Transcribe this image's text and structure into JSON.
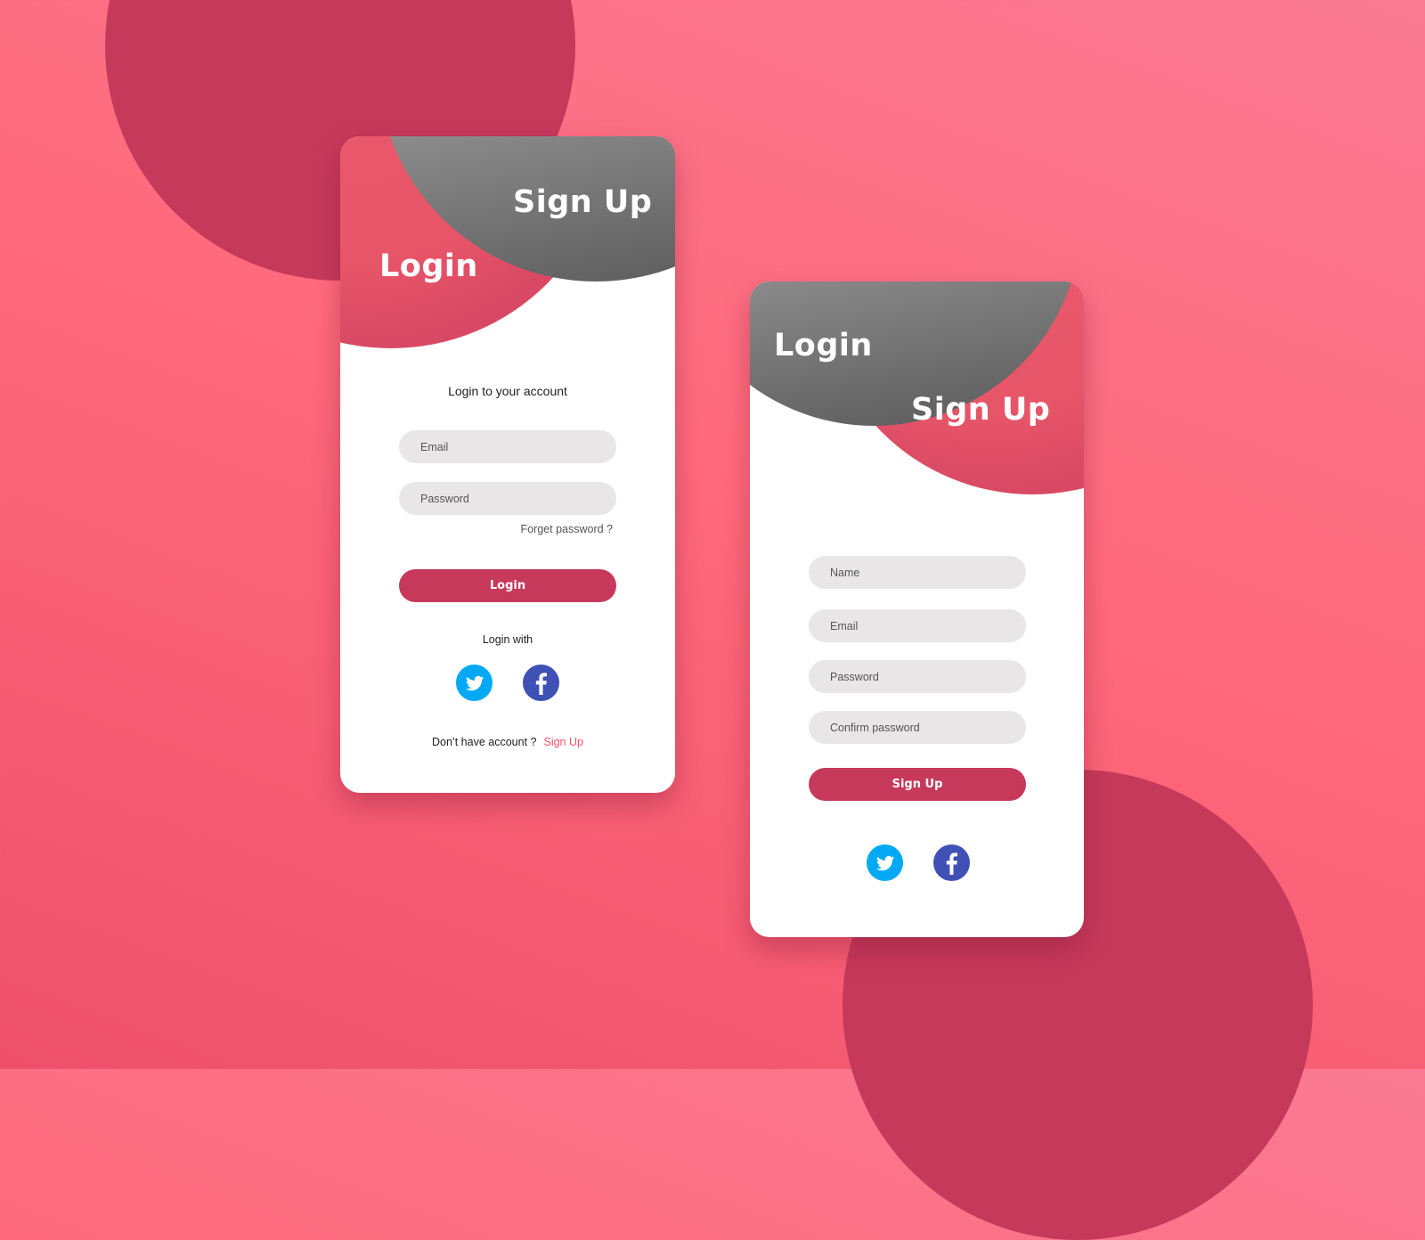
{
  "colors": {
    "background_light": "#fa7a93",
    "background_dark": "#ee506b",
    "accent": "#c6395b",
    "header_pink": "#e75569",
    "header_gray": "#8e8e8e",
    "input_bg": "#e8e6e7",
    "link": "#f0506b",
    "twitter": "#03a9f4",
    "facebook": "#3f51b5"
  },
  "login_card": {
    "header": {
      "primary_label": "Login",
      "secondary_label": "Sign Up"
    },
    "subtitle": "Login to your account",
    "fields": [
      {
        "name": "email",
        "placeholder": "Email",
        "value": ""
      },
      {
        "name": "password",
        "placeholder": "Password",
        "value": ""
      }
    ],
    "forget_password": "Forget password ?",
    "submit_label": "Login",
    "social_label": "Login with",
    "social": [
      {
        "icon": "twitter-icon"
      },
      {
        "icon": "facebook-icon"
      }
    ],
    "footer": {
      "text": "Don’t have account ?",
      "link": "Sign Up"
    }
  },
  "signup_card": {
    "header": {
      "primary_label": "Sign Up",
      "secondary_label": "Login"
    },
    "fields": [
      {
        "name": "name",
        "placeholder": "Name",
        "value": ""
      },
      {
        "name": "email",
        "placeholder": "Email",
        "value": ""
      },
      {
        "name": "password",
        "placeholder": "Password",
        "value": ""
      },
      {
        "name": "confirm_password",
        "placeholder": "Confirm password",
        "value": ""
      }
    ],
    "submit_label": "Sign Up",
    "social": [
      {
        "icon": "twitter-icon"
      },
      {
        "icon": "facebook-icon"
      }
    ]
  }
}
